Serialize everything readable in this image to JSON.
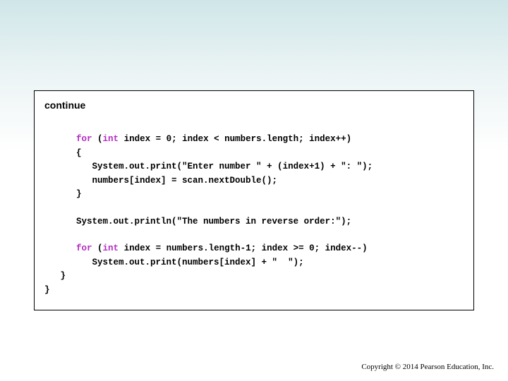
{
  "slide": {
    "continue_label": "continue",
    "code": {
      "kw_for": "for",
      "kw_int": "int",
      "l1_a": " (",
      "l1_b": " index = 0; index < numbers.length; index++)",
      "l2": "{",
      "l3": "   System.out.print(\"Enter number \" + (index+1) + \": \");",
      "l4": "   numbers[index] = scan.nextDouble();",
      "l5": "}",
      "l7": "System.out.println(\"The numbers in reverse order:\");",
      "l9_a": " (",
      "l9_b": " index = numbers.length-1; index >= 0; index--)",
      "l10": "   System.out.print(numbers[index] + \"  \");",
      "l11": "   }",
      "l12": "}"
    },
    "copyright": "Copyright © 2014 Pearson Education, Inc."
  }
}
